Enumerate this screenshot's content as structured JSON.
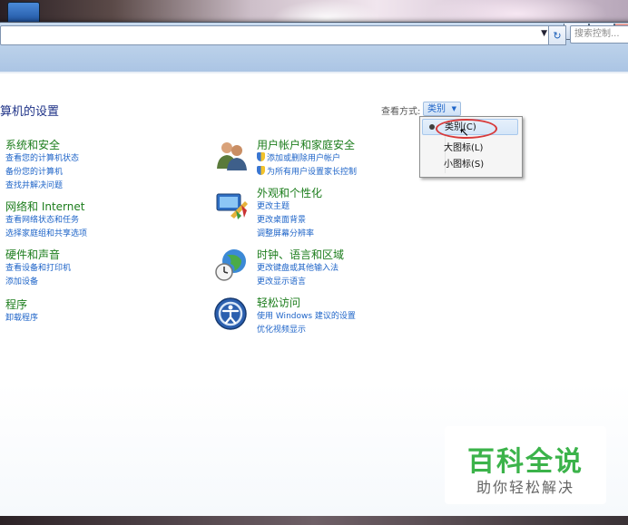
{
  "search": {
    "placeholder": "搜索控制..."
  },
  "page": {
    "title": "算机的设置"
  },
  "view_by": {
    "label": "查看方式:",
    "value": "类别"
  },
  "view_menu": {
    "items": [
      {
        "label": "类别(C)",
        "selected": true
      },
      {
        "label": "大图标(L)",
        "selected": false
      },
      {
        "label": "小图标(S)",
        "selected": false
      }
    ]
  },
  "categories_left": [
    {
      "title": "系统和安全",
      "links": [
        "查看您的计算机状态",
        "备份您的计算机",
        "查找并解决问题"
      ]
    },
    {
      "title": "网络和 Internet",
      "links": [
        "查看网络状态和任务",
        "选择家庭组和共享选项"
      ]
    },
    {
      "title": "硬件和声音",
      "links": [
        "查看设备和打印机",
        "添加设备"
      ]
    },
    {
      "title": "程序",
      "links": [
        "卸载程序"
      ]
    }
  ],
  "categories_right": [
    {
      "title": "用户帐户和家庭安全",
      "links": [
        "添加或删除用户帐户",
        "为所有用户设置家长控制"
      ],
      "icon": "users-icon"
    },
    {
      "title": "外观和个性化",
      "links": [
        "更改主题",
        "更改桌面背景",
        "调整屏幕分辨率"
      ],
      "icon": "appearance-icon"
    },
    {
      "title": "时钟、语言和区域",
      "links": [
        "更改键盘或其他输入法",
        "更改显示语言"
      ],
      "icon": "clock-globe-icon"
    },
    {
      "title": "轻松访问",
      "links": [
        "使用 Windows 建议的设置",
        "优化视频显示"
      ],
      "icon": "ease-of-access-icon"
    }
  ],
  "watermark": {
    "title": "百科全说",
    "subtitle": "助你轻松解决"
  },
  "colors": {
    "link": "#1e64c8",
    "category_title": "#1c7d1c",
    "highlight": "#d83a3a",
    "watermark": "#3bb34a"
  }
}
